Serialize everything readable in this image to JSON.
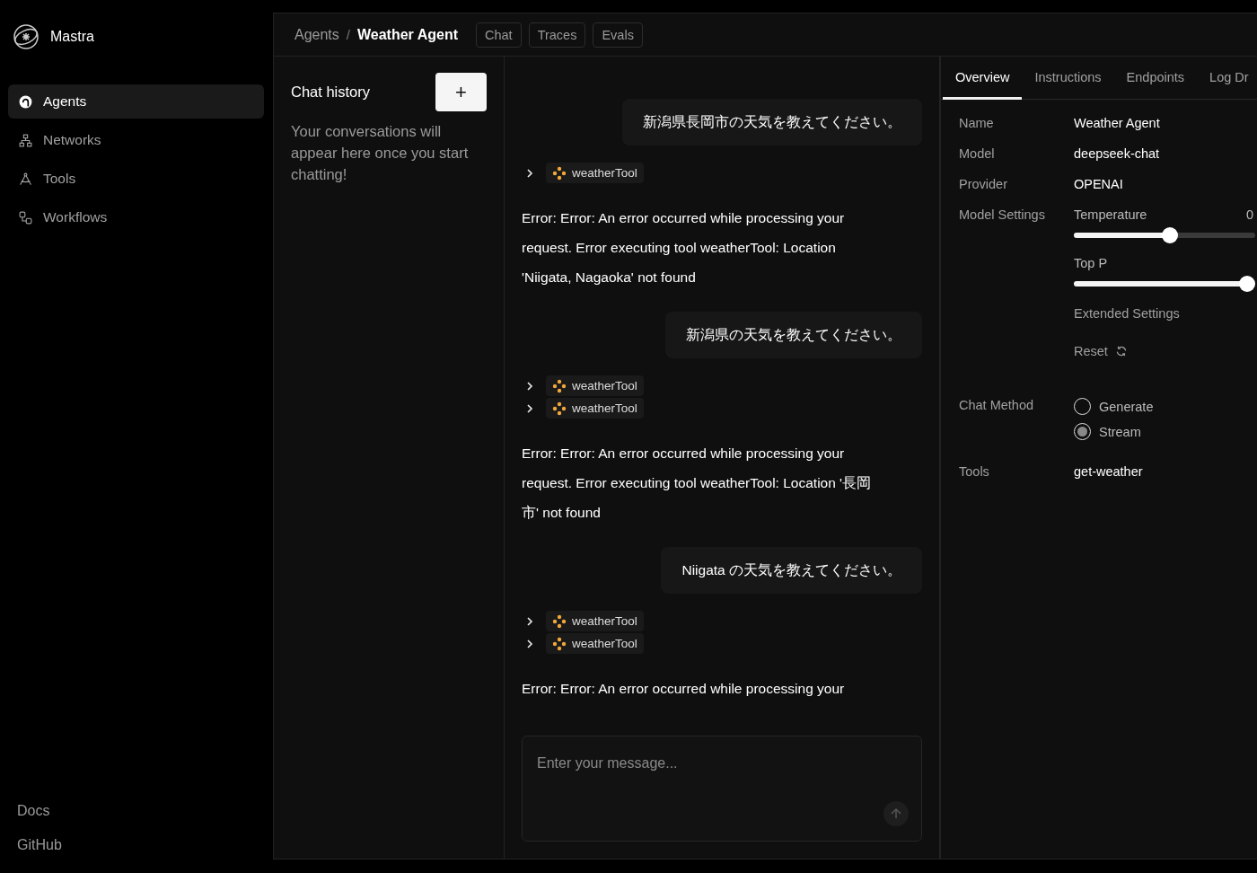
{
  "sidebar": {
    "brand": "Mastra",
    "items": [
      {
        "label": "Agents",
        "selected": true
      },
      {
        "label": "Networks",
        "selected": false
      },
      {
        "label": "Tools",
        "selected": false
      },
      {
        "label": "Workflows",
        "selected": false
      }
    ],
    "footer_links": [
      "Docs",
      "GitHub"
    ]
  },
  "header": {
    "breadcrumb": [
      "Agents",
      "Weather Agent"
    ],
    "separator": "/",
    "tabs": [
      "Chat",
      "Traces",
      "Evals"
    ]
  },
  "chat_history": {
    "title": "Chat history",
    "new_button": "+",
    "empty_text": "Your conversations will appear here once you start chatting!"
  },
  "messages": [
    {
      "kind": "user",
      "text": "新潟県長岡市の天気を教えてください。"
    },
    {
      "kind": "tools",
      "tools": [
        "weatherTool"
      ]
    },
    {
      "kind": "assistant",
      "text": "Error: Error: An error occurred while processing your request. Error executing tool weatherTool: Location 'Niigata, Nagaoka' not found"
    },
    {
      "kind": "user",
      "text": "新潟県の天気を教えてください。"
    },
    {
      "kind": "tools",
      "tools": [
        "weatherTool",
        "weatherTool"
      ]
    },
    {
      "kind": "assistant",
      "text": "Error: Error: An error occurred while processing your request. Error executing tool weatherTool: Location '長岡市' not found"
    },
    {
      "kind": "user",
      "text": "Niigata の天気を教えてください。"
    },
    {
      "kind": "tools",
      "tools": [
        "weatherTool",
        "weatherTool"
      ]
    },
    {
      "kind": "assistant",
      "text": "Error: Error: An error occurred while processing your"
    }
  ],
  "composer": {
    "placeholder": "Enter your message..."
  },
  "details": {
    "tabs": [
      {
        "label": "Overview",
        "selected": true
      },
      {
        "label": "Instructions",
        "selected": false
      },
      {
        "label": "Endpoints",
        "selected": false
      },
      {
        "label": "Log Dr",
        "selected": false
      }
    ],
    "fields": [
      {
        "label": "Name",
        "value": "Weather Agent"
      },
      {
        "label": "Model",
        "value": "deepseek-chat"
      },
      {
        "label": "Provider",
        "value": "OPENAI"
      }
    ],
    "model_settings": {
      "label": "Model Settings",
      "sliders": [
        {
          "name": "Temperature",
          "reading": "0",
          "level": 0.53
        },
        {
          "name": "Top P",
          "level": 1
        }
      ],
      "extended": "Extended Settings",
      "reset": "Reset"
    },
    "chat_method": {
      "label": "Chat Method",
      "options": [
        {
          "label": "Generate",
          "selected": false
        },
        {
          "label": "Stream",
          "selected": true
        }
      ]
    },
    "tools": {
      "label": "Tools",
      "value": "get-weather"
    }
  }
}
